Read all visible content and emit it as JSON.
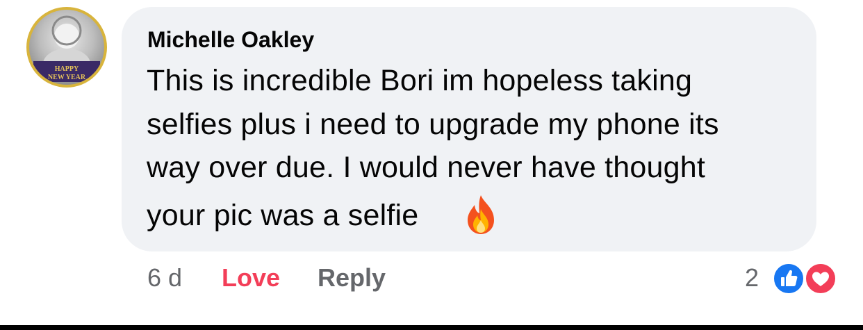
{
  "comment": {
    "author": "Michelle Oakley",
    "text_lines": [
      "This is incredible Bori im hopeless taking",
      "selfies plus i need to upgrade my phone its",
      "way over due. I would never have thought",
      "your pic was a selfie"
    ],
    "emoji": "fire-icon",
    "avatar_text": [
      "HAPPY",
      "NEW YEAR"
    ]
  },
  "footer": {
    "timestamp": "6 d",
    "love_label": "Love",
    "reply_label": "Reply",
    "reaction_count": "2",
    "reactions": [
      "like-icon",
      "love-icon"
    ]
  },
  "colors": {
    "bubble": "#f0f2f5",
    "text": "#050505",
    "secondary": "#65676b",
    "love": "#f33e58",
    "like": "#1877f2"
  }
}
